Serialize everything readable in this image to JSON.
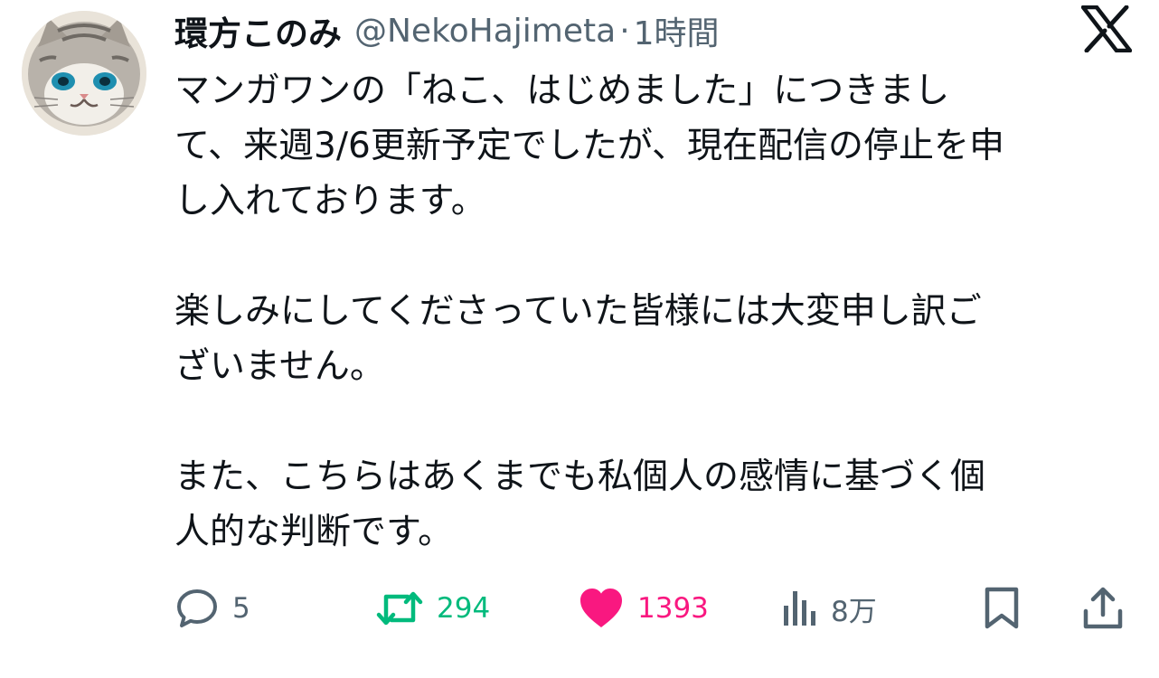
{
  "author": {
    "display_name": "環方このみ",
    "handle": "@NekoHajimeta",
    "separator": "·",
    "time": "1時間"
  },
  "icons": {
    "avatar": "cat-avatar",
    "platform": "x-logo",
    "reply": "reply-icon",
    "retweet": "retweet-icon",
    "like": "heart-icon",
    "views": "views-icon",
    "bookmark": "bookmark-icon",
    "share": "share-icon"
  },
  "tweet": {
    "paragraphs": [
      {
        "lines": [
          "マンガワンの「ねこ、はじめました」につきまし",
          "て、来週3/6更新予定でしたが、現在配信の停止を申",
          "し入れております。"
        ]
      },
      {
        "lines": [
          "楽しみにしてくださっていた皆様には大変申し訳ご",
          "ざいません。"
        ]
      },
      {
        "lines": [
          "また、こちらはあくまでも私個人の感情に基づく個",
          "人的な判断です。"
        ]
      }
    ]
  },
  "metrics": {
    "replies": "5",
    "retweets": "294",
    "likes": "1393",
    "views": "8万"
  },
  "colors": {
    "text": "#0f1419",
    "secondary": "#536471",
    "retweet_active": "#00ba7c",
    "like_active": "#f91880"
  }
}
